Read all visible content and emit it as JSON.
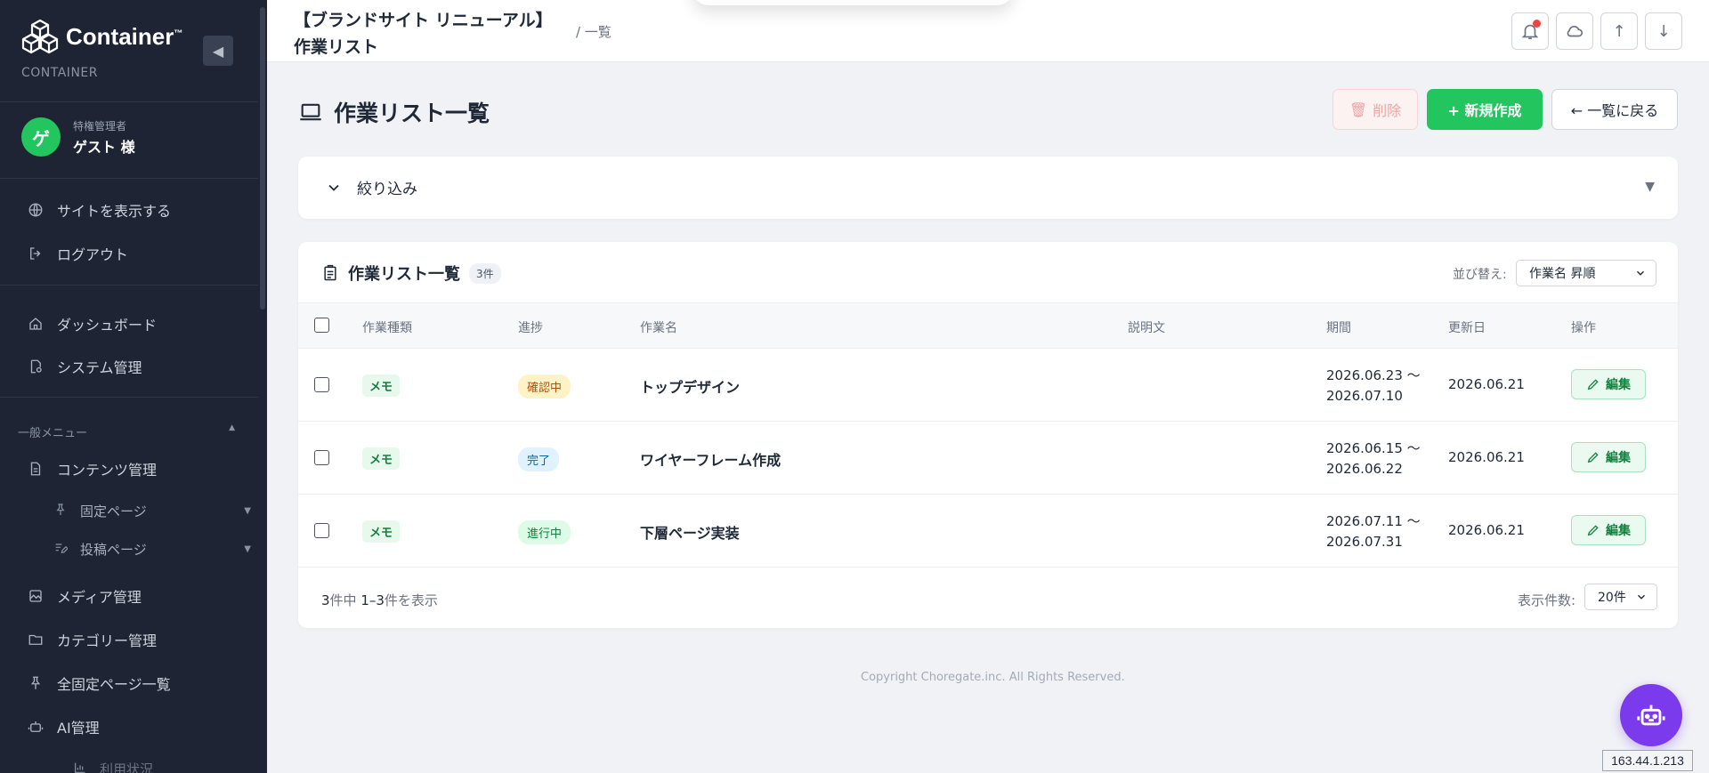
{
  "brand": {
    "name": "Container",
    "tm": "™",
    "sub": "CONTAINER"
  },
  "user": {
    "avatar": "ゲ",
    "role": "特権管理者",
    "name": "ゲスト 様"
  },
  "sidebar": {
    "top_links": [
      {
        "label": "サイトを表示する",
        "icon": "globe-icon"
      },
      {
        "label": "ログアウト",
        "icon": "logout-icon"
      }
    ],
    "main": [
      {
        "label": "ダッシュボード",
        "icon": "home-icon"
      },
      {
        "label": "システム管理",
        "icon": "settings-doc-icon"
      }
    ],
    "section_label": "一般メニュー",
    "general": [
      {
        "label": "コンテンツ管理",
        "icon": "document-icon"
      },
      {
        "label": "固定ページ",
        "icon": "pin-icon"
      },
      {
        "label": "投稿ページ",
        "icon": "post-icon"
      },
      {
        "label": "メディア管理",
        "icon": "image-icon"
      },
      {
        "label": "カテゴリー管理",
        "icon": "folder-icon"
      },
      {
        "label": "全固定ページ一覧",
        "icon": "pin-icon"
      },
      {
        "label": "AI管理",
        "icon": "robot-icon"
      },
      {
        "label": "利用状況",
        "icon": "chart-icon"
      }
    ]
  },
  "header": {
    "title_line1": "【ブランドサイト リニューアル】",
    "title_line2": "作業リスト",
    "breadcrumb": "/ 一覧",
    "buttons": {
      "up": "↑",
      "down": "↓"
    }
  },
  "page": {
    "heading": "作業リスト一覧",
    "delete_label": "削除",
    "new_label": "+ 新規作成",
    "back_label": "← 一覧に戻る"
  },
  "filter": {
    "label": "絞り込み",
    "caret": "▼"
  },
  "list": {
    "title": "作業リスト一覧",
    "count": "3件",
    "sort_label": "並び替え:",
    "sort_value": "作業名 昇順",
    "columns": [
      "作業種類",
      "進捗",
      "作業名",
      "説明文",
      "期間",
      "更新日",
      "操作"
    ],
    "rows": [
      {
        "type": "メモ",
        "status": "確認中",
        "name": "トップデザイン",
        "description": "",
        "period_start": "2026.06.23 〜",
        "period_end": "2026.07.10",
        "updated": "2026.06.21",
        "action": "編集"
      },
      {
        "type": "メモ",
        "status": "完了",
        "name": "ワイヤーフレーム作成",
        "description": "",
        "period_start": "2026.06.15 〜",
        "period_end": "2026.06.22",
        "updated": "2026.06.21",
        "action": "編集"
      },
      {
        "type": "メモ",
        "status": "進行中",
        "name": "下層ページ実装",
        "description": "",
        "period_start": "2026.07.11 〜",
        "period_end": "2026.07.31",
        "updated": "2026.06.21",
        "action": "編集"
      }
    ],
    "footer": {
      "total": "3",
      "total_suffix": "件中 ",
      "range": "1–3",
      "range_suffix": "件を表示",
      "perpage_label": "表示件数:",
      "perpage_value": "20件"
    }
  },
  "status_colors": {
    "確認中": "#fef3c7",
    "完了": "#e0f2fe",
    "進行中": "#dcfce7"
  },
  "copyright": "Copyright Choregate.inc. All Rights Reserved.",
  "ip": "163.44.1.213",
  "accent": "#22c55e"
}
